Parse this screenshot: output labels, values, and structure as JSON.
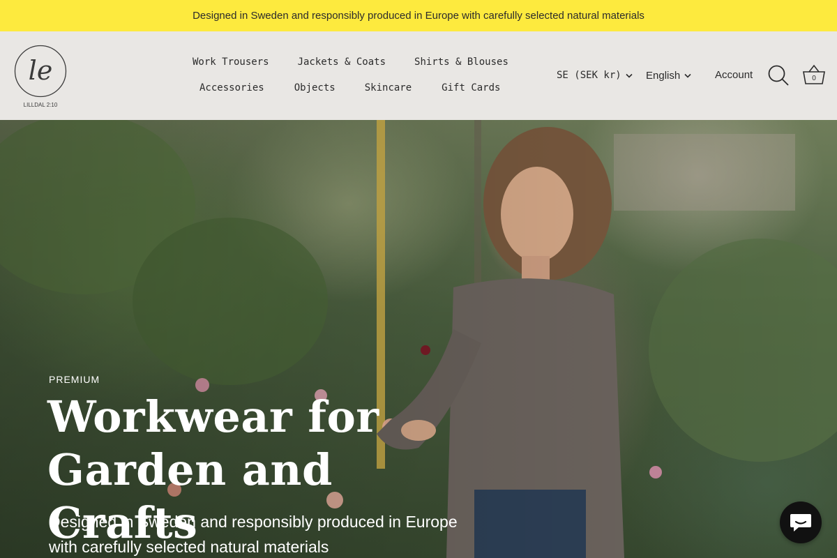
{
  "announcement": "Designed in Sweden and responsibly produced in Europe with carefully selected natural materials",
  "brand": {
    "logo_text": "LILLDAL 2:10",
    "monogram": "le"
  },
  "nav": {
    "row1": [
      "Work Trousers",
      "Jackets & Coats",
      "Shirts & Blouses"
    ],
    "row2": [
      "Accessories",
      "Objects",
      "Skincare",
      "Gift Cards"
    ]
  },
  "utility": {
    "currency": "SE (SEK kr)",
    "language": "English",
    "account": "Account",
    "cart_count": "0"
  },
  "hero": {
    "eyebrow": "PREMIUM",
    "title_line1": "Workwear for",
    "title_line2": "Garden and Crafts",
    "subtitle_line1": "Designed in Sweden and responsibly produced in Europe",
    "subtitle_line2": "with carefully selected natural materials"
  },
  "colors": {
    "announcement_bg": "#fdea3e",
    "header_bg": "#e9e7e4",
    "chat_bg": "#111111"
  },
  "icons": [
    "chevron-down-icon",
    "search-icon",
    "basket-icon",
    "chat-icon"
  ]
}
